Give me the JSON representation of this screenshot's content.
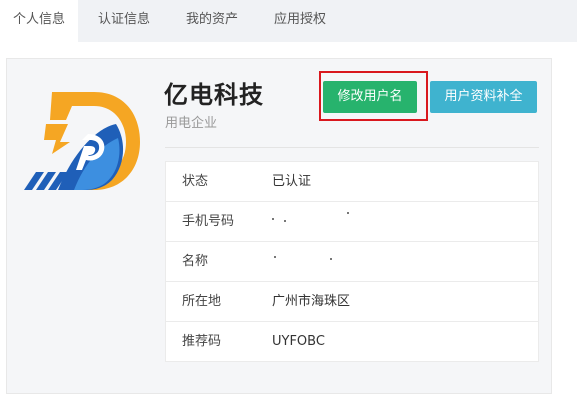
{
  "tabs": [
    {
      "label": "个人信息",
      "active": true
    },
    {
      "label": "认证信息",
      "active": false
    },
    {
      "label": "我的资产",
      "active": false
    },
    {
      "label": "应用授权",
      "active": false
    }
  ],
  "profile": {
    "company_name": "亿电科技",
    "company_type": "用电企业",
    "logo_icon": "yidian-logo-icon"
  },
  "buttons": {
    "edit_username": "修改用户名",
    "complete_profile": "用户资料补全"
  },
  "info": {
    "rows": [
      {
        "label": "状态",
        "value": "已认证"
      },
      {
        "label": "手机号码",
        "value": ""
      },
      {
        "label": "名称",
        "value": ""
      },
      {
        "label": "所在地",
        "value": "广州市海珠区"
      },
      {
        "label": "推荐码",
        "value": "UYFOBC"
      }
    ]
  },
  "colors": {
    "edit_button": "#27b36d",
    "complete_button": "#3fb3cf",
    "highlight": "#d9181e",
    "logo_orange": "#f5a623",
    "logo_blue": "#1f5fb8"
  }
}
